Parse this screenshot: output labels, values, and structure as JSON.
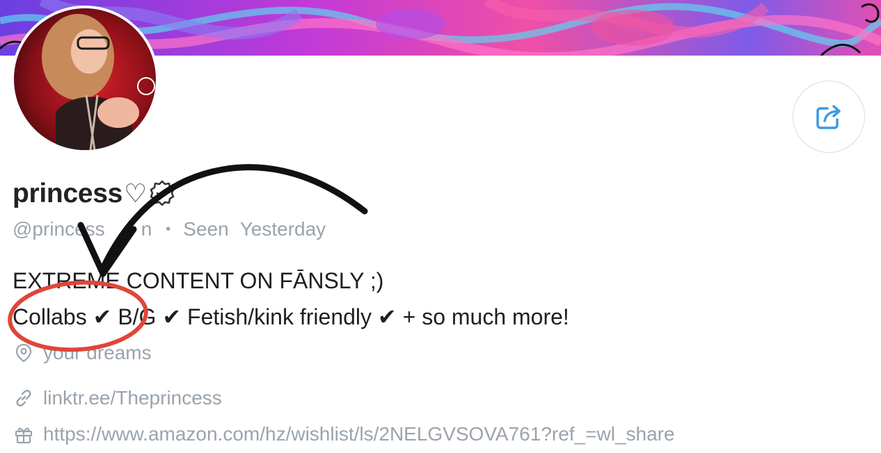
{
  "profile": {
    "display_name": "princess",
    "name_suffix": "♡",
    "username": "@princess",
    "username_tail": "n",
    "seen_label": "Seen",
    "seen_value": "Yesterday"
  },
  "bio": {
    "line1": "EXTREME CONTENT ON FĀNSLY ;)",
    "line2": "Collabs ✔ B/G ✔ Fetish/kink friendly ✔ + so much more!"
  },
  "info": {
    "location": "your dreams",
    "link": "linktr.ee/Theprincess",
    "wishlist": "https://www.amazon.com/hz/wishlist/ls/2NELGVSOVA761?ref_=wl_share"
  },
  "icons": {
    "share": "share-icon",
    "verified": "verified-badge-icon",
    "location": "location-pin-icon",
    "link": "link-icon",
    "gift": "gift-icon"
  },
  "colors": {
    "accent": "#3b9be6",
    "muted": "#9aa3ad",
    "annotation_red": "#e0453a"
  }
}
